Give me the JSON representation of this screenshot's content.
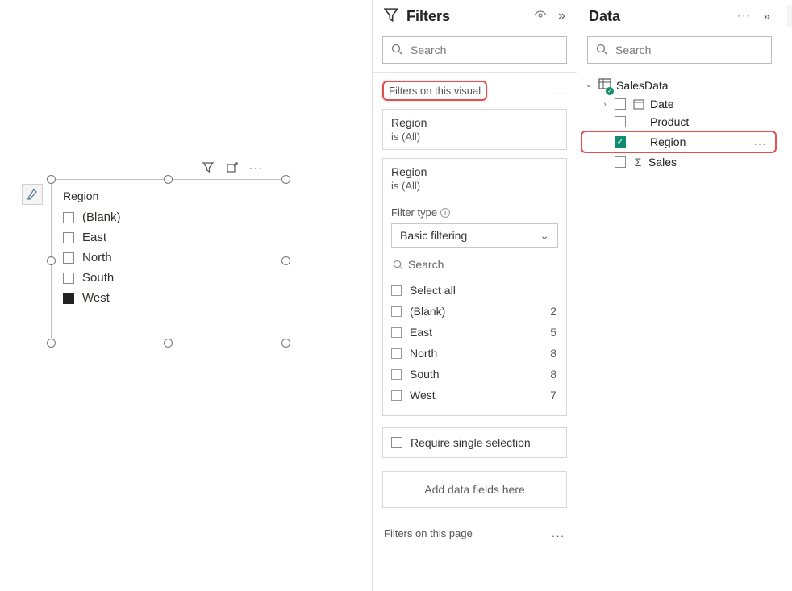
{
  "canvas": {
    "paint_icon": "paint-format",
    "visual_toolbar": {
      "filter": "filter-icon",
      "focus": "focus-mode-icon",
      "more": "..."
    },
    "slicer": {
      "title": "Region",
      "items": [
        {
          "label": "(Blank)",
          "checked": false
        },
        {
          "label": "East",
          "checked": false
        },
        {
          "label": "North",
          "checked": false
        },
        {
          "label": "South",
          "checked": false
        },
        {
          "label": "West",
          "checked": true
        }
      ]
    }
  },
  "filters": {
    "title": "Filters",
    "search_placeholder": "Search",
    "section_visual": "Filters on this visual",
    "card1": {
      "field": "Region",
      "summary": "is (All)"
    },
    "card2": {
      "field": "Region",
      "summary": "is (All)",
      "filter_type_label": "Filter type",
      "filter_type_value": "Basic filtering",
      "inner_search_placeholder": "Search",
      "select_all": "Select all",
      "options": [
        {
          "label": "(Blank)",
          "count": 2
        },
        {
          "label": "East",
          "count": 5
        },
        {
          "label": "North",
          "count": 8
        },
        {
          "label": "South",
          "count": 8
        },
        {
          "label": "West",
          "count": 7
        }
      ]
    },
    "require_single": "Require single selection",
    "add_fields": "Add data fields here",
    "section_page": "Filters on this page"
  },
  "data": {
    "title": "Data",
    "search_placeholder": "Search",
    "table": {
      "name": "SalesData",
      "expanded": true
    },
    "fields": [
      {
        "name": "Date",
        "type": "hierarchy",
        "checked": false,
        "expandable": true
      },
      {
        "name": "Product",
        "type": "text",
        "checked": false
      },
      {
        "name": "Region",
        "type": "text",
        "checked": true,
        "highlight": true
      },
      {
        "name": "Sales",
        "type": "numeric",
        "checked": false
      }
    ]
  },
  "rail": {
    "items": [
      "data-icon",
      "model-icon",
      "viz-icon",
      "add-icon"
    ]
  }
}
